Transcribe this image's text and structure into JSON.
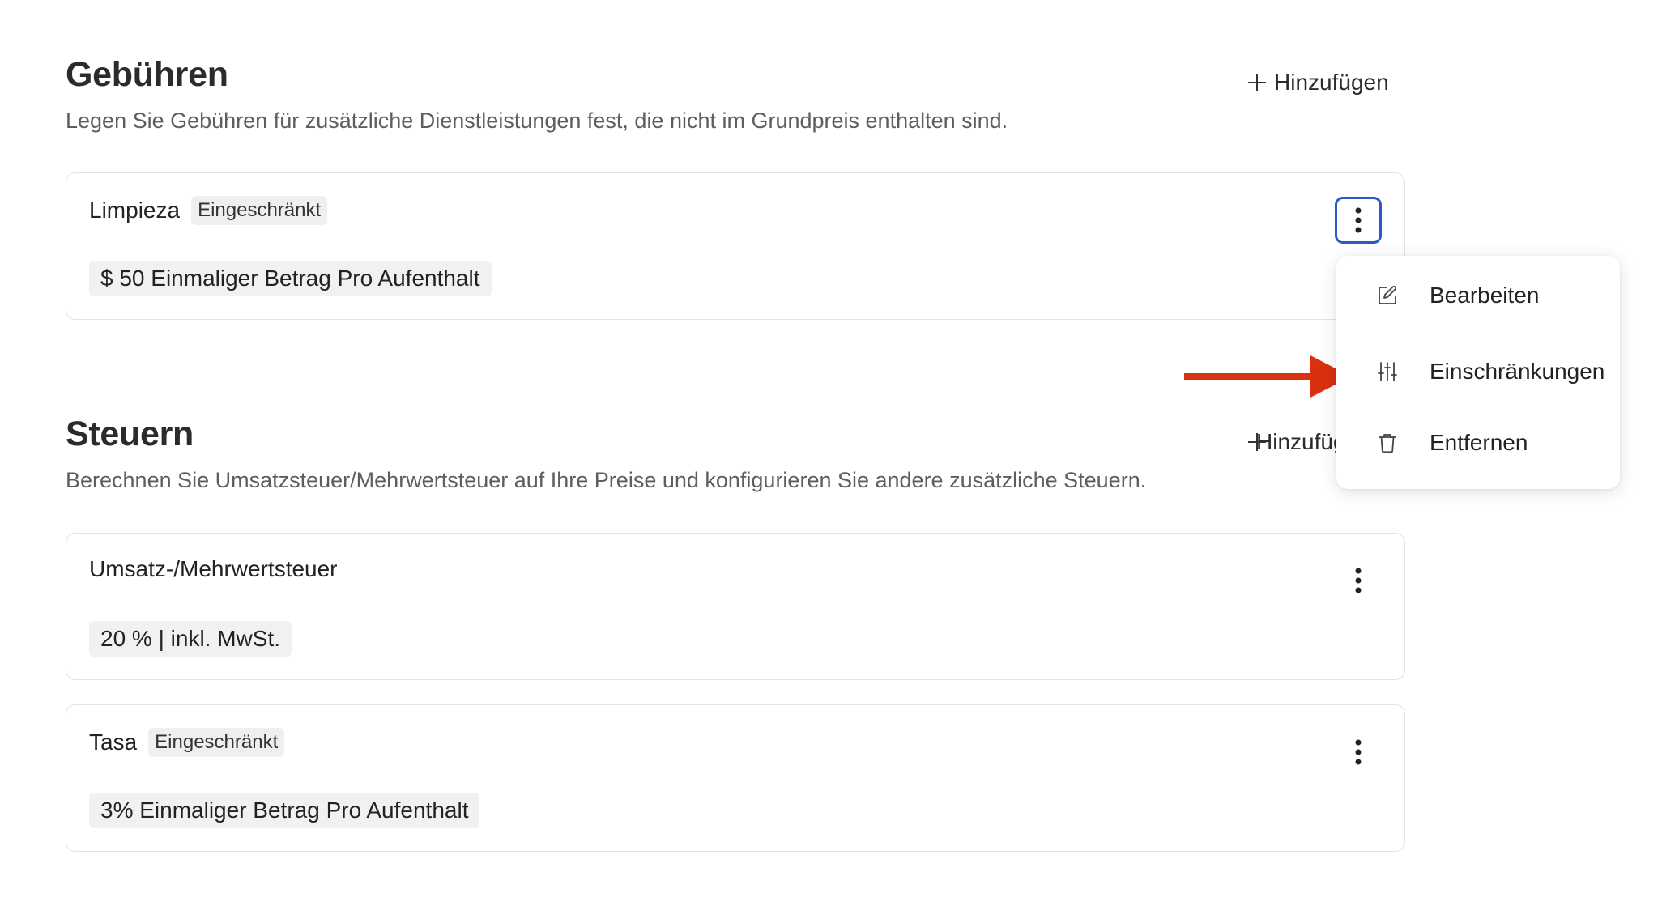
{
  "fees": {
    "title": "Gebühren",
    "description": "Legen Sie Gebühren für zusätzliche Dienstleistungen fest, die nicht im Grundpreis enthalten sind.",
    "add_label": "Hinzufügen",
    "items": [
      {
        "name": "Limpieza",
        "badge": "Eingeschränkt",
        "detail": "$ 50 Einmaliger Betrag Pro Aufenthalt"
      }
    ]
  },
  "taxes": {
    "title": "Steuern",
    "description": "Berechnen Sie Umsatzsteuer/Mehrwertsteuer auf Ihre Preise und konfigurieren Sie andere zusätzliche Steuern.",
    "add_label": "Hinzufügen",
    "add_label_visible": "Hinzu",
    "items": [
      {
        "name": "Umsatz-/Mehrwertsteuer",
        "badge": "",
        "detail": "20 % | inkl. MwSt."
      },
      {
        "name": "Tasa",
        "badge": "Eingeschränkt",
        "detail": "3% Einmaliger Betrag Pro Aufenthalt"
      }
    ]
  },
  "context_menu": {
    "items": [
      {
        "label": "Bearbeiten",
        "icon": "edit-icon"
      },
      {
        "label": "Einschränkungen",
        "icon": "sliders-icon"
      },
      {
        "label": "Entfernen",
        "icon": "trash-icon"
      }
    ]
  },
  "colors": {
    "focus_ring": "#2d58c7",
    "annotation_arrow": "#d9300f"
  }
}
